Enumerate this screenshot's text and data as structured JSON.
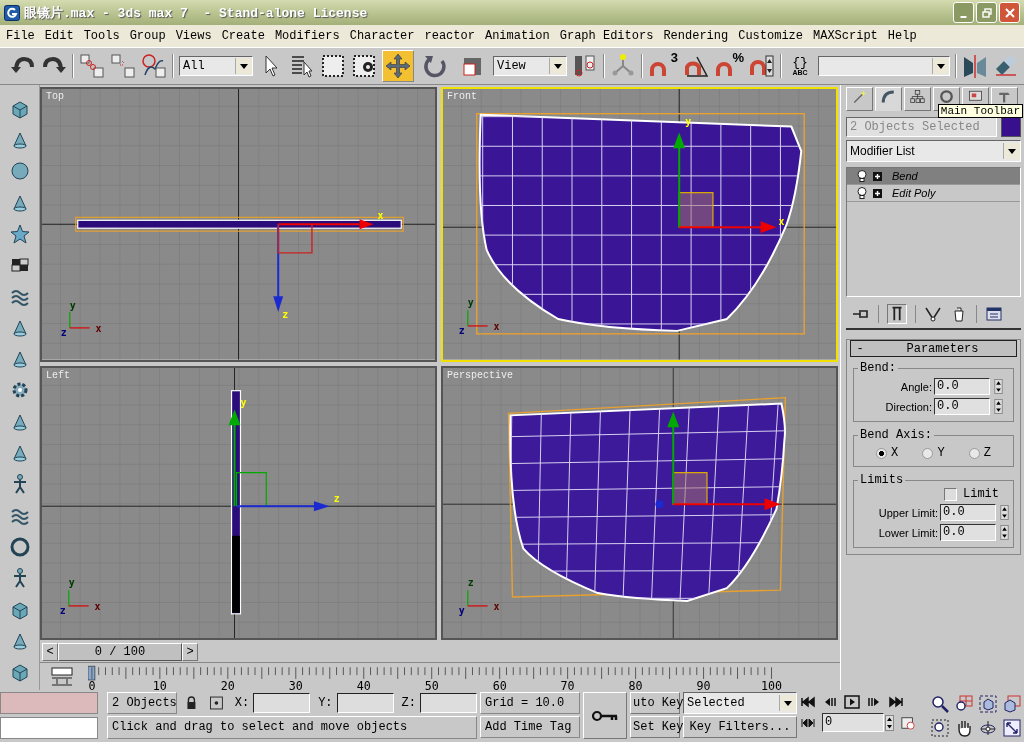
{
  "window": {
    "title": "眼镜片.max - 3ds max 7  - Stand-alone License"
  },
  "menu": [
    {
      "label": "File"
    },
    {
      "label": "Edit"
    },
    {
      "label": "Tools"
    },
    {
      "label": "Group"
    },
    {
      "label": "Views"
    },
    {
      "label": "Create"
    },
    {
      "label": "Modifiers"
    },
    {
      "label": "Character"
    },
    {
      "label": "reactor"
    },
    {
      "label": "Animation"
    },
    {
      "label": "Graph Editors"
    },
    {
      "label": "Rendering"
    },
    {
      "label": "Customize"
    },
    {
      "label": "MAXScript"
    },
    {
      "label": "Help"
    }
  ],
  "toolbar": {
    "selection_filter": "All",
    "reference_coordinate": "View",
    "transform_tools": [
      {
        "kind": "move",
        "selected": true
      },
      {
        "kind": "rotate",
        "selected": false
      },
      {
        "kind": "scale",
        "selected": false
      }
    ],
    "snap_badges": [
      "3",
      "%"
    ],
    "named_sets_icon": {
      "braces": "{}",
      "caption": "ABC"
    }
  },
  "viewports": [
    {
      "label": "Top",
      "kind": "top",
      "selected": false,
      "gizmo_labels": [
        "x",
        "z"
      ],
      "triad_labels": [
        "y",
        "z",
        "x"
      ]
    },
    {
      "label": "Front",
      "kind": "front",
      "selected": true,
      "gizmo_labels": [
        "y",
        "x"
      ],
      "triad_labels": [
        "y",
        "z",
        "x"
      ]
    },
    {
      "label": "Left",
      "kind": "left",
      "selected": false,
      "gizmo_labels": [
        "y",
        "z"
      ],
      "triad_labels": [
        "y",
        "z",
        "x"
      ]
    },
    {
      "label": "Perspective",
      "kind": "perspective",
      "selected": false,
      "triad_labels": [
        "z",
        "y",
        "x"
      ]
    }
  ],
  "command_panel": {
    "tooltip": "Main Toolbar",
    "tabs": [
      {
        "kind": "create",
        "selected": false
      },
      {
        "kind": "modify",
        "selected": true
      },
      {
        "kind": "hierarchy",
        "selected": false
      },
      {
        "kind": "motion",
        "selected": false
      },
      {
        "kind": "display",
        "selected": false
      },
      {
        "kind": "utilities",
        "selected": false
      }
    ],
    "object_name": "2 Objects Selected",
    "modifier_list": "Modifier List",
    "stack": [
      {
        "name": "Bend",
        "selected": true
      },
      {
        "name": "Edit Poly",
        "selected": false
      }
    ],
    "rollout": {
      "title": "Parameters",
      "toggle": "-",
      "groups": [
        {
          "title": "Bend:",
          "kind": "fields",
          "fields": [
            {
              "label": "Angle:",
              "value": "0.0"
            },
            {
              "label": "Direction:",
              "value": "0.0"
            }
          ]
        },
        {
          "title": "Bend Axis:",
          "kind": "radios",
          "options": [
            {
              "label": "X",
              "selected": true
            },
            {
              "label": "Y",
              "selected": false
            },
            {
              "label": "Z",
              "selected": false
            }
          ]
        },
        {
          "title": "Limits",
          "kind": "limits",
          "checkbox": {
            "label": "Limit",
            "checked": false
          },
          "fields": [
            {
              "label": "Upper Limit:",
              "value": "0.0"
            },
            {
              "label": "Lower Limit:",
              "value": "0.0"
            }
          ]
        }
      ]
    }
  },
  "timeline": {
    "prev": "<",
    "position": "0 / 100",
    "next": ">",
    "ruler_labels": [
      "0",
      "10",
      "20",
      "30",
      "40",
      "50",
      "60",
      "70",
      "80",
      "90",
      "100"
    ]
  },
  "status": {
    "selection": "2 Objects",
    "coords": [
      {
        "label": "X:"
      },
      {
        "label": "Y:"
      },
      {
        "label": "Z:"
      }
    ],
    "grid": "Grid = 10.0",
    "prompt": "Click and drag to select and move objects",
    "time_tag": "Add Time Tag"
  },
  "animation": {
    "auto_key": "uto Key",
    "set_key": "Set Key",
    "key_set": "Selected",
    "key_filters": "Key Filters...",
    "frame": "0"
  }
}
